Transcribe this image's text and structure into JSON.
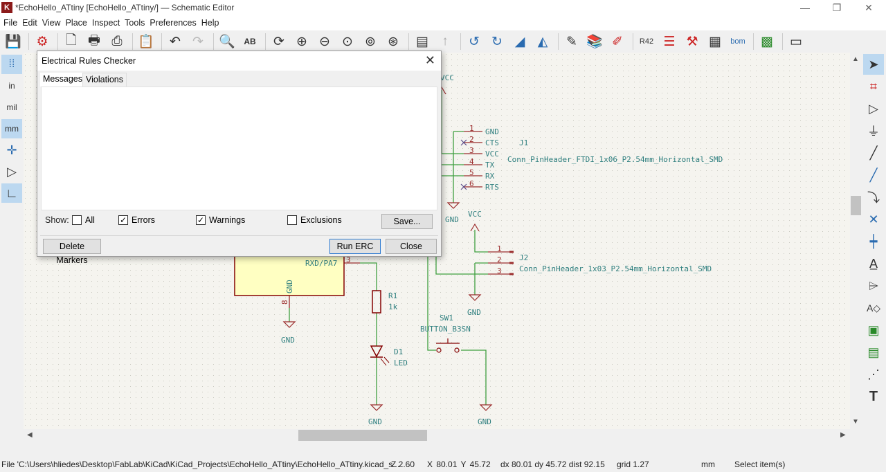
{
  "window": {
    "title": "*EchoHello_ATtiny [EchoHello_ATtiny/] — Schematic Editor",
    "minimize": "—",
    "restore": "❐",
    "close": "✕"
  },
  "menu": [
    "File",
    "Edit",
    "View",
    "Place",
    "Inspect",
    "Tools",
    "Preferences",
    "Help"
  ],
  "toolbar_icons": [
    "save-icon",
    "schematic-setup-icon",
    "page-settings-icon",
    "print-icon",
    "plot-icon",
    "paste-icon",
    "undo-icon",
    "redo-icon",
    "find-icon",
    "find-replace-icon",
    "refresh-icon",
    "zoom-in-icon",
    "zoom-out-icon",
    "zoom-fit-icon",
    "zoom-objects-icon",
    "zoom-selection-icon",
    "hierarchy-icon",
    "leave-sheet-icon",
    "rotate-ccw-icon",
    "rotate-cw-icon",
    "mirror-vertical-icon",
    "mirror-horizontal-icon",
    "symbol-editor-icon",
    "symbol-browser-icon",
    "annotate-icon",
    "erc-icon",
    "assign-footprints-icon",
    "edit-fields-icon",
    "bom-icon",
    "open-pcb-icon",
    "scripting-console-icon"
  ],
  "left_toolbar": [
    {
      "name": "grid-toggle",
      "label": "⁞⁞",
      "active": true
    },
    {
      "name": "units-in",
      "label": "in",
      "active": false
    },
    {
      "name": "units-mil",
      "label": "mil",
      "active": false
    },
    {
      "name": "units-mm",
      "label": "mm",
      "active": true
    },
    {
      "name": "cursor-crosshair",
      "label": "✛",
      "active": false
    },
    {
      "name": "hidden-pins",
      "label": "▷",
      "active": false
    },
    {
      "name": "orthogonal-lines",
      "label": "∟",
      "active": true
    }
  ],
  "right_toolbar": [
    "select-icon",
    "highlight-net-icon",
    "add-symbol-icon",
    "add-power-icon",
    "add-wire-icon",
    "add-bus-icon",
    "bus-entry-icon",
    "no-connect-icon",
    "junction-icon",
    "net-label-icon",
    "global-label-icon",
    "hierarchical-label-icon",
    "add-sheet-icon",
    "import-sheet-pin-icon",
    "graphic-line-icon",
    "add-text-icon"
  ],
  "erc_dialog": {
    "title": "Electrical Rules Checker",
    "tabs": [
      "Messages",
      "Violations"
    ],
    "show_label": "Show:",
    "filters": [
      {
        "label": "All",
        "checked": false
      },
      {
        "label": "Errors",
        "checked": true
      },
      {
        "label": "Warnings",
        "checked": true
      },
      {
        "label": "Exclusions",
        "checked": false
      }
    ],
    "save": "Save...",
    "delete_markers": "Delete Markers",
    "run_erc": "Run ERC",
    "close": "Close"
  },
  "schematic": {
    "vcc_top": "VCC",
    "j1": {
      "ref": "J1",
      "value": "Conn_PinHeader_FTDI_1x06_P2.54mm_Horizontal_SMD",
      "pins": [
        {
          "num": "1",
          "name": "GND"
        },
        {
          "num": "2",
          "name": "CTS"
        },
        {
          "num": "3",
          "name": "VCC"
        },
        {
          "num": "4",
          "name": "TX"
        },
        {
          "num": "5",
          "name": "RX"
        },
        {
          "num": "6",
          "name": "RTS"
        }
      ],
      "gnd": "GND"
    },
    "j2": {
      "ref": "J2",
      "value": "Conn_PinHeader_1x03_P2.54mm_Horizontal_SMD",
      "pins": [
        "1",
        "2",
        "3"
      ],
      "vcc": "VCC",
      "gnd": "GND"
    },
    "u1": {
      "pin_rxd": "RXD/PA7",
      "pin_rxd_num": "3",
      "pin_gnd": "GND",
      "pin_gnd_num": "8",
      "gnd": "GND"
    },
    "r1": {
      "ref": "R1",
      "value": "1k"
    },
    "d1": {
      "ref": "D1",
      "value": "LED",
      "gnd": "GND"
    },
    "sw1": {
      "ref": "SW1",
      "value": "BUTTON_B3SN",
      "gnd": "GND"
    },
    "colors": {
      "wire": "#3f9f3f",
      "pin": "#9b2c2c",
      "text": "#2f7f7f",
      "body": "#ffffc2",
      "background": "#f5f4ef"
    }
  },
  "status": {
    "file": "File 'C:\\Users\\hliedes\\Desktop\\FabLab\\KiCad\\KiCad_Projects\\EchoHello_ATtiny\\EchoHello_ATtiny.kicad_s...",
    "zoom": "Z 2.60",
    "xy": "X 80.01  Y 45.72",
    "delta": "dx 80.01  dy 45.72  dist 92.15",
    "grid": "grid 1.27",
    "units": "mm",
    "mode": "Select item(s)"
  }
}
